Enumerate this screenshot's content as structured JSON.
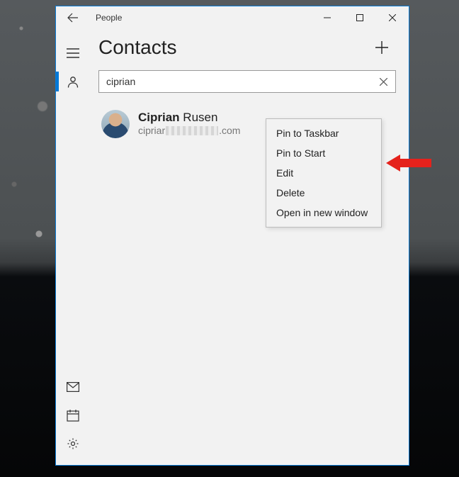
{
  "window": {
    "title": "People"
  },
  "page": {
    "title": "Contacts"
  },
  "search": {
    "value": "ciprian"
  },
  "contact": {
    "name_bold": "Ciprian",
    "name_rest": " Rusen",
    "email_prefix": "cipriar",
    "email_suffix": ".com"
  },
  "context_menu": {
    "items": [
      "Pin to Taskbar",
      "Pin to Start",
      "Edit",
      "Delete",
      "Open in new window"
    ]
  },
  "icons": {
    "back": "back-arrow",
    "minimize": "minimize",
    "maximize": "maximize",
    "close": "close",
    "hamburger": "hamburger",
    "person": "person",
    "mail": "mail",
    "calendar": "calendar",
    "settings": "gear",
    "add": "plus",
    "clear": "x"
  },
  "annotation": {
    "arrow_target": "Pin to Start"
  }
}
